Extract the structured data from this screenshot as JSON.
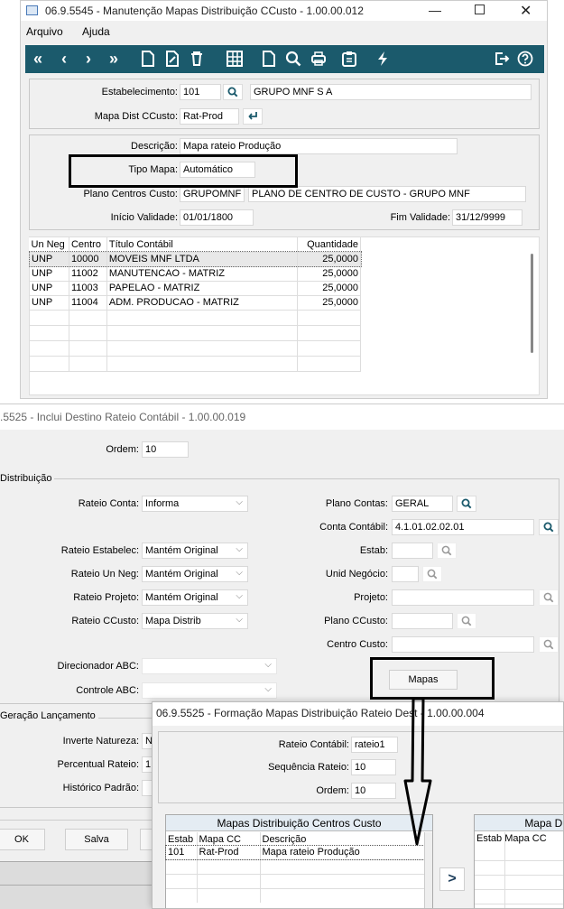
{
  "win1": {
    "title": "06.9.5545 - Manutenção Mapas Distribuição CCusto - 1.00.00.012",
    "menu": [
      "Arquivo",
      "Ajuda"
    ],
    "estabelecimento_label": "Estabelecimento:",
    "estabelecimento_value": "101",
    "estabelecimento_name": "GRUPO MNF S A",
    "mapa_label": "Mapa Dist CCusto:",
    "mapa_value": "Rat-Prod",
    "descricao_label": "Descrição:",
    "descricao_value": "Mapa rateio Produção",
    "tipo_label": "Tipo Mapa:",
    "tipo_value": "Automático",
    "plano_label": "Plano Centros Custo:",
    "plano_value": "GRUPOMNF",
    "plano_desc": "PLANO DE CENTRO DE CUSTO - GRUPO MNF",
    "inicio_label": "Início Validade:",
    "inicio_value": "01/01/1800",
    "fim_label": "Fim Validade:",
    "fim_value": "31/12/9999",
    "table_headers": [
      "Un Neg",
      "Centro",
      "Título Contábil",
      "Quantidade"
    ],
    "rows": [
      [
        "UNP",
        "10000",
        "MOVEIS MNF LTDA",
        "25,0000"
      ],
      [
        "UNP",
        "11002",
        "MANUTENCAO - MATRIZ",
        "25,0000"
      ],
      [
        "UNP",
        "11003",
        "PAPELAO - MATRIZ",
        "25,0000"
      ],
      [
        "UNP",
        "11004",
        "ADM. PRODUCAO - MATRIZ",
        "25,0000"
      ]
    ]
  },
  "win2": {
    "title": ".5525 - Inclui Destino Rateio Contábil - 1.00.00.019",
    "ordem_label": "Ordem:",
    "ordem_value": "10",
    "distribuicao_label": "Distribuição",
    "rateio_conta_label": "Rateio Conta:",
    "rateio_conta_value": "Informa",
    "rateio_estab_label": "Rateio Estabelec:",
    "rateio_estab_value": "Mantém Original",
    "rateio_un_label": "Rateio Un Neg:",
    "rateio_un_value": "Mantém Original",
    "rateio_proj_label": "Rateio Projeto:",
    "rateio_proj_value": "Mantém Original",
    "rateio_cc_label": "Rateio CCusto:",
    "rateio_cc_value": "Mapa Distrib",
    "plano_contas_label": "Plano Contas:",
    "plano_contas_value": "GERAL",
    "conta_label": "Conta Contábil:",
    "conta_value": "4.1.01.02.02.01",
    "estab_label": "Estab:",
    "unid_label": "Unid Negócio:",
    "projeto_label": "Projeto:",
    "plano_cc_label": "Plano CCusto:",
    "centro_label": "Centro Custo:",
    "direcionador_label": "Direcionador ABC:",
    "controle_label": "Controle ABC:",
    "mapas_button": "Mapas",
    "geracao_label": "Geração Lançamento",
    "inverte_label": "Inverte Natureza:",
    "inverte_value": "N",
    "percentual_label": "Percentual Rateio:",
    "percentual_value": "1",
    "historico_label": "Histórico Padrão:",
    "ok_button": "OK",
    "salva_button": "Salva"
  },
  "win3": {
    "title": "06.9.5525 - Formação Mapas Distribuição Rateio Dest - 1.00.00.004",
    "rateio_label": "Rateio Contábil:",
    "rateio_value": "rateio1",
    "seq_label": "Sequência Rateio:",
    "seq_value": "10",
    "ordem_label": "Ordem:",
    "ordem_value": "10",
    "left_title": "Mapas Distribuição Centros Custo",
    "left_headers": [
      "Estab",
      "Mapa CC",
      "Descrição"
    ],
    "left_row": [
      "101",
      "Rat-Prod",
      "Mapa rateio Produção"
    ],
    "right_title": "Mapa Di",
    "right_headers": [
      "Estab",
      "Mapa CC"
    ],
    "move_button": ">"
  }
}
